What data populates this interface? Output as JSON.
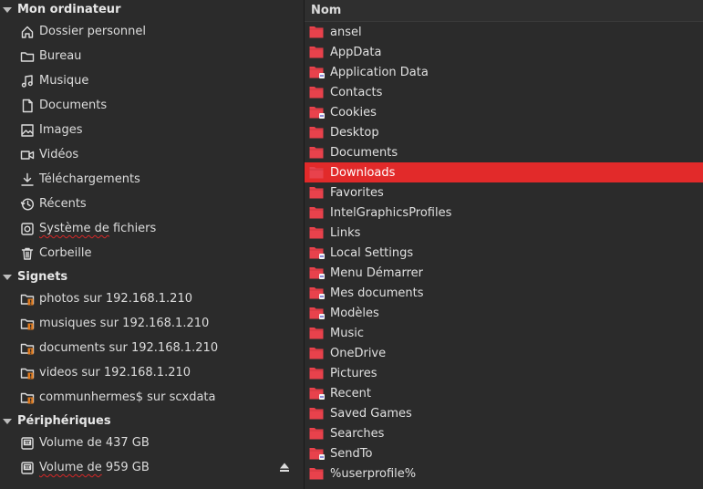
{
  "sidebar": {
    "computer": {
      "title": "Mon ordinateur",
      "items": [
        {
          "label": "Dossier personnel",
          "icon": "home-icon"
        },
        {
          "label": "Bureau",
          "icon": "folder-outline-icon"
        },
        {
          "label": "Musique",
          "icon": "music-note-icon"
        },
        {
          "label": "Documents",
          "icon": "document-icon"
        },
        {
          "label": "Images",
          "icon": "image-icon"
        },
        {
          "label": "Vidéos",
          "icon": "video-icon"
        },
        {
          "label": "Téléchargements",
          "icon": "download-icon"
        },
        {
          "label": "Récents",
          "icon": "clock-icon"
        },
        {
          "label": "Système de fichiers",
          "icon": "drive-icon"
        },
        {
          "label": "Corbeille",
          "icon": "trash-icon"
        }
      ]
    },
    "bookmarks": {
      "title": "Signets",
      "items": [
        {
          "label": "photos sur 192.168.1.210",
          "icon": "network-folder-icon"
        },
        {
          "label": "musiques sur 192.168.1.210",
          "icon": "network-folder-icon"
        },
        {
          "label": "documents sur 192.168.1.210",
          "icon": "network-folder-icon"
        },
        {
          "label": "videos sur 192.168.1.210",
          "icon": "network-folder-icon"
        },
        {
          "label": "communhermes$ sur scxdata",
          "icon": "network-folder-icon"
        }
      ]
    },
    "devices": {
      "title": "Périphériques",
      "items": [
        {
          "label": "Volume de 437 GB",
          "icon": "disk-icon"
        },
        {
          "label": "Volume de 959 GB",
          "icon": "disk-icon",
          "eject": "eject-icon"
        }
      ]
    }
  },
  "file_list": {
    "column_header": "Nom",
    "selected": "Downloads",
    "files": [
      {
        "name": "ansel",
        "link": false
      },
      {
        "name": "AppData",
        "link": false
      },
      {
        "name": "Application Data",
        "link": true
      },
      {
        "name": "Contacts",
        "link": false
      },
      {
        "name": "Cookies",
        "link": true
      },
      {
        "name": "Desktop",
        "link": false
      },
      {
        "name": "Documents",
        "link": false
      },
      {
        "name": "Downloads",
        "link": false
      },
      {
        "name": "Favorites",
        "link": false
      },
      {
        "name": "IntelGraphicsProfiles",
        "link": false
      },
      {
        "name": "Links",
        "link": false
      },
      {
        "name": "Local Settings",
        "link": true
      },
      {
        "name": "Menu Démarrer",
        "link": true
      },
      {
        "name": "Mes documents",
        "link": true
      },
      {
        "name": "Modèles",
        "link": true
      },
      {
        "name": "Music",
        "link": false
      },
      {
        "name": "OneDrive",
        "link": false
      },
      {
        "name": "Pictures",
        "link": false
      },
      {
        "name": "Recent",
        "link": true
      },
      {
        "name": "Saved Games",
        "link": false
      },
      {
        "name": "Searches",
        "link": false
      },
      {
        "name": "SendTo",
        "link": true
      },
      {
        "name": "%userprofile%",
        "link": false
      }
    ]
  },
  "colors": {
    "accent": "#e22a2a",
    "folder": "#e8424c",
    "background": "#2b2b2b"
  }
}
